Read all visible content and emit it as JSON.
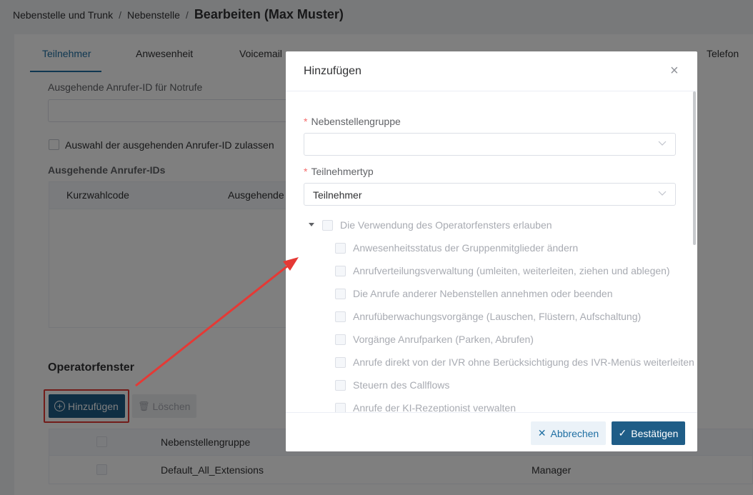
{
  "breadcrumb": {
    "item1": "Nebenstelle und Trunk",
    "item2": "Nebenstelle",
    "separator": "/",
    "current": "Bearbeiten (Max Muster)"
  },
  "tabs": [
    {
      "label": "Teilnehmer",
      "active": true
    },
    {
      "label": "Anwesenheit"
    },
    {
      "label": "Voicemail"
    },
    {
      "label": "Telefon"
    }
  ],
  "form": {
    "emergency_callerid_label": "Ausgehende Anrufer-ID für Notrufe",
    "emergency_callerid_value": "",
    "allow_callerid_label": "Auswahl der ausgehenden Anrufer-ID zulassen",
    "outgoing_ids_title": "Ausgehende Anrufer-IDs",
    "table_headers": [
      "Kurzwahlcode",
      "Ausgehende"
    ]
  },
  "operator": {
    "title": "Operatorfenster",
    "add_label": "Hinzufügen",
    "delete_label": "Löschen",
    "headers": [
      "Nebenstellengruppe"
    ],
    "rows": [
      {
        "group": "Default_All_Extensions",
        "role": "Manager"
      }
    ]
  },
  "dialog": {
    "title": "Hinzufügen",
    "close_symbol": "×",
    "required_marker": "*",
    "group_label": "Nebenstellengruppe",
    "group_value": "",
    "type_label": "Teilnehmertyp",
    "type_value": "Teilnehmer",
    "parent_permission": "Die Verwendung des Operatorfensters erlauben",
    "permissions": [
      "Anwesenheitsstatus der Gruppenmitglieder ändern",
      "Anrufverteilungsverwaltung (umleiten, weiterleiten, ziehen und ablegen)",
      "Die Anrufe anderer Nebenstellen annehmen oder beenden",
      "Anrufüberwachungsvorgänge (Lauschen, Flüstern, Aufschaltung)",
      "Vorgänge Anrufparken (Parken, Abrufen)",
      "Anrufe direkt von der IVR ohne Berücksichtigung des IVR-Menüs weiterleiten",
      "Steuern des Callflows",
      "Anrufe der KI-Rezeptionist verwalten"
    ],
    "cancel_label": "Abbrechen",
    "confirm_label": "Bestätigen"
  },
  "colors": {
    "primary": "#1f5d87",
    "active_tab": "#1f6fa3",
    "annotation": "#e53935"
  }
}
